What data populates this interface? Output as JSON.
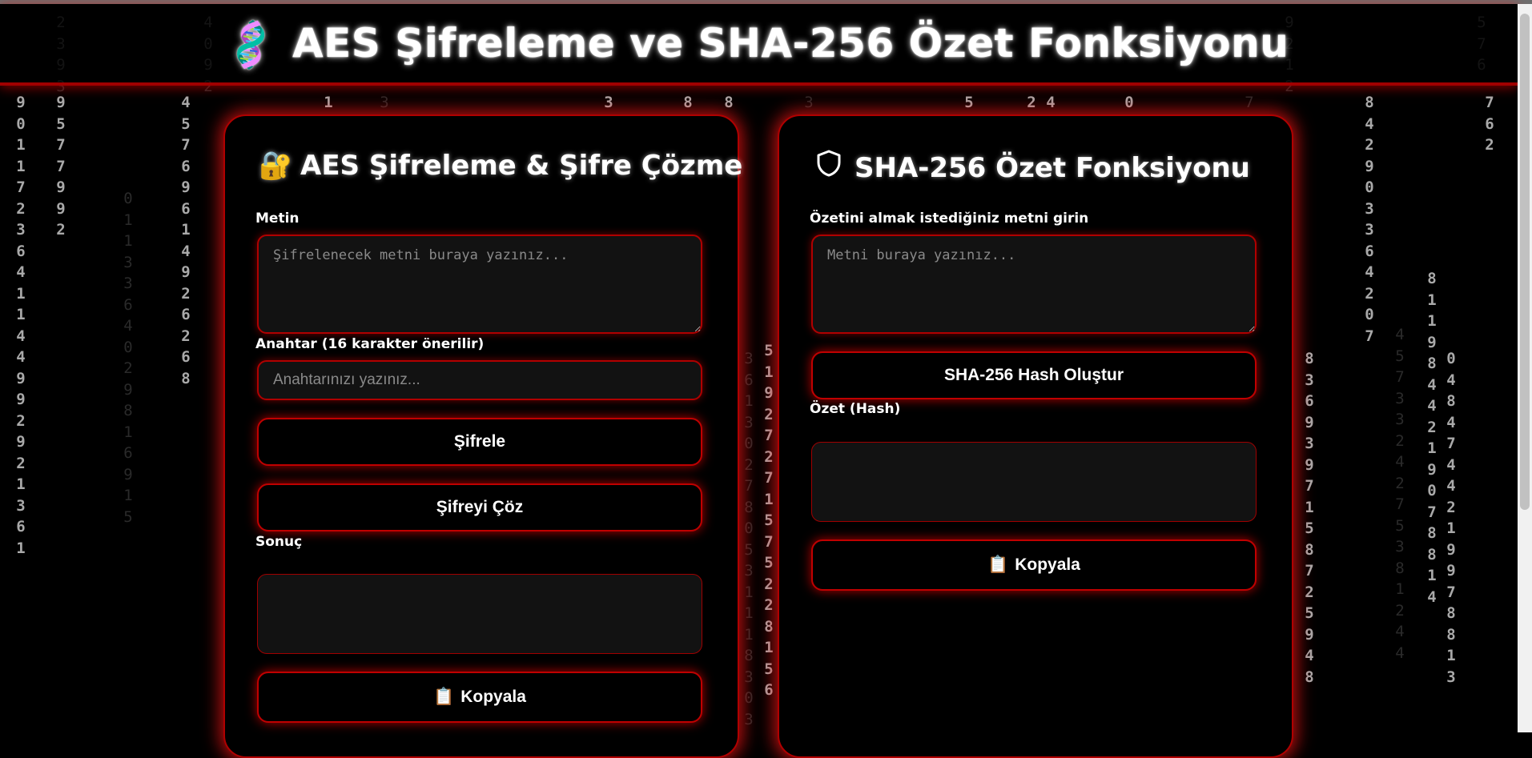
{
  "header": {
    "icon": "dna-icon",
    "title": "AES Şifreleme ve SHA-256 Özet Fonksiyonu"
  },
  "aes": {
    "icon": "lock-key-icon",
    "title": "AES Şifreleme & Şifre Çözme",
    "text_label": "Metin",
    "text_placeholder": "Şifrelenecek metni buraya yazınız...",
    "key_label": "Anahtar (16 karakter önerilir)",
    "key_placeholder": "Anahtarınızı yazınız...",
    "encrypt_button": "Şifrele",
    "decrypt_button": "Şifreyi Çöz",
    "result_label": "Sonuç",
    "result_value": "",
    "copy_button": "Kopyala"
  },
  "sha": {
    "icon": "shield-icon",
    "title": "SHA-256 Özet Fonksiyonu",
    "text_label": "Özetini almak istediğiniz metni girin",
    "text_placeholder": "Metni buraya yazınız...",
    "hash_button": "SHA-256 Hash Oluştur",
    "hash_label": "Özet (Hash)",
    "hash_value": "",
    "copy_button": "Kopyala"
  },
  "colors": {
    "accent": "#ff1a1a",
    "border": "#b00000",
    "background": "#000000",
    "field": "#121212"
  }
}
